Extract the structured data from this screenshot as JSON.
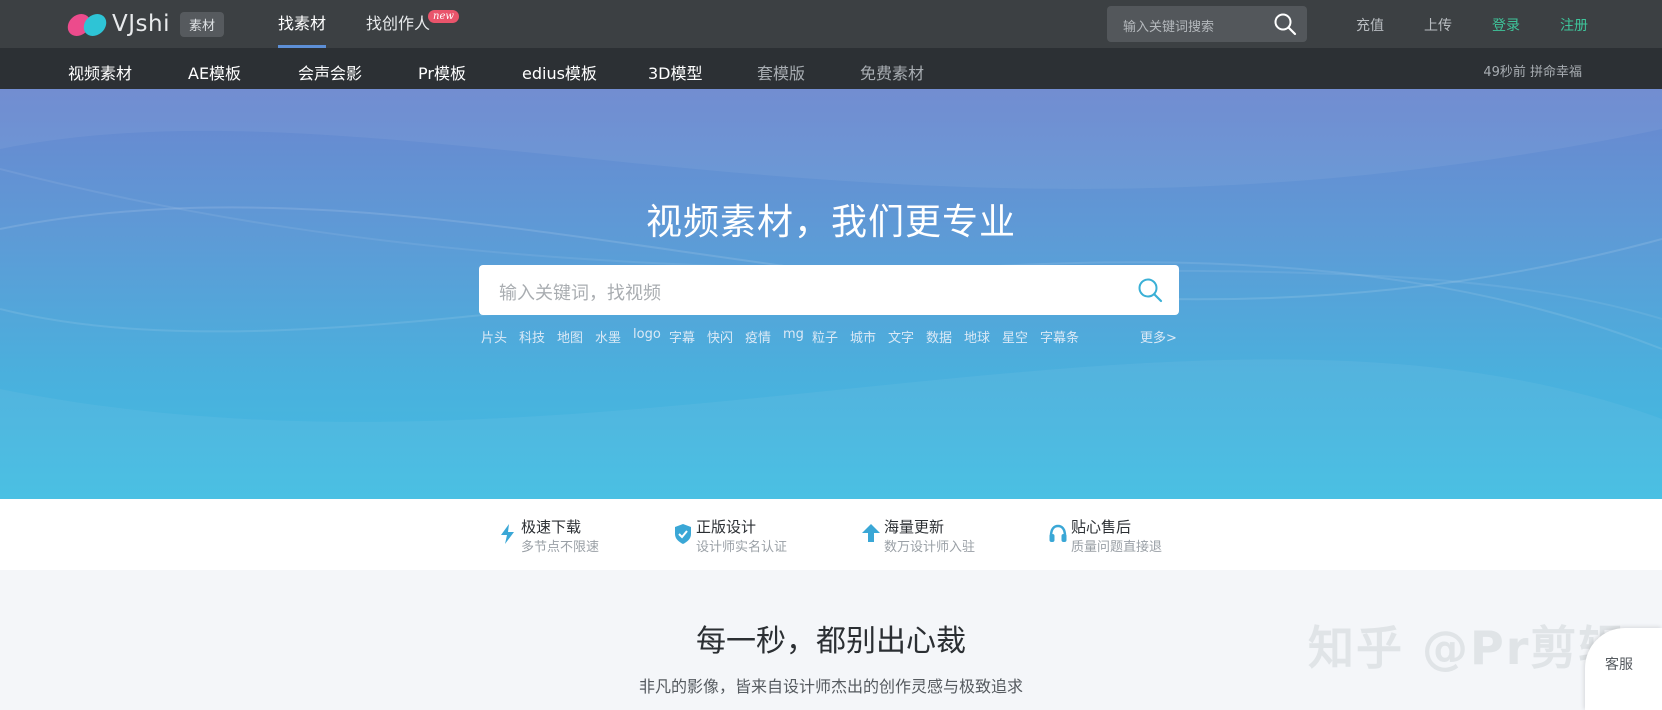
{
  "brand": {
    "name": "VJshi",
    "badge": "素材"
  },
  "topnav": [
    {
      "label": "找素材",
      "active": true
    },
    {
      "label": "找创作人",
      "badge": "new"
    }
  ],
  "top_search": {
    "placeholder": "输入关键词搜索"
  },
  "top_links": {
    "recharge": "充值",
    "upload": "上传",
    "login": "登录",
    "register": "注册"
  },
  "categories": [
    "视频素材",
    "AE模板",
    "会声会影",
    "Pr模板",
    "edius模板",
    "3D模型",
    "套模版",
    "免费素材"
  ],
  "activity": "49秒前 拼命幸福",
  "hero": {
    "title": "视频素材，我们更专业",
    "search_placeholder": "输入关键词，找视频",
    "tags": [
      "片头",
      "科技",
      "地图",
      "水墨",
      "logo",
      "字幕",
      "快闪",
      "疫情",
      "mg",
      "粒子",
      "城市",
      "文字",
      "数据",
      "地球",
      "星空",
      "字幕条"
    ],
    "more": "更多>"
  },
  "features": [
    {
      "title": "极速下载",
      "sub": "多节点不限速",
      "icon": "lightning-icon"
    },
    {
      "title": "正版设计",
      "sub": "设计师实名认证",
      "icon": "shield-check-icon"
    },
    {
      "title": "海量更新",
      "sub": "数万设计师入驻",
      "icon": "arrow-up-icon"
    },
    {
      "title": "贴心售后",
      "sub": "质量问题直接退",
      "icon": "headset-icon"
    }
  ],
  "section": {
    "title": "每一秒，都别出心裁",
    "subtitle": "非凡的影像，皆来自设计师杰出的创作灵感与极致追求"
  },
  "watermark": "知乎 @Pr剪辑",
  "service_label": "客服",
  "colors": {
    "topbar": "#3c4043",
    "catbar": "#2c3034",
    "accent_green": "#3ec49a",
    "hero_top": "#6a86cf",
    "hero_bottom": "#41bde2",
    "icon_cyan": "#3aa7d6"
  }
}
